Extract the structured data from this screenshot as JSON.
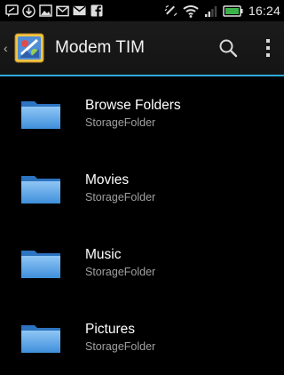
{
  "status_bar": {
    "left_icons": [
      "sms-icon",
      "download-icon",
      "image-icon",
      "gmail-icon",
      "email-icon",
      "facebook-icon"
    ],
    "right_icons": [
      "vibrate-icon",
      "wifi-icon",
      "signal-icon",
      "battery-icon"
    ],
    "time": "16:24"
  },
  "action_bar": {
    "title": "Modem TIM",
    "accent_color": "#2fa8d9"
  },
  "items": [
    {
      "title": "Browse Folders",
      "subtitle": "StorageFolder"
    },
    {
      "title": "Movies",
      "subtitle": "StorageFolder"
    },
    {
      "title": "Music",
      "subtitle": "StorageFolder"
    },
    {
      "title": "Pictures",
      "subtitle": "StorageFolder"
    }
  ]
}
